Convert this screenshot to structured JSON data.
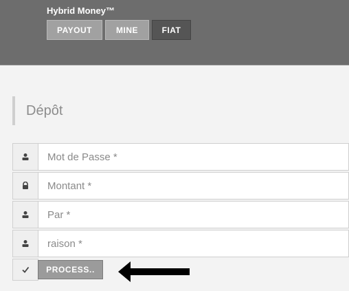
{
  "header": {
    "brand": "Hybrid Money™",
    "tabs": [
      {
        "label": "PAYOUT"
      },
      {
        "label": "MINE"
      },
      {
        "label": "FIAT",
        "active": true
      }
    ]
  },
  "section": {
    "title": "Dépôt"
  },
  "form": {
    "fields": [
      {
        "placeholder": "Mot de Passe *",
        "icon": "user-icon"
      },
      {
        "placeholder": "Montant *",
        "icon": "lock-icon"
      },
      {
        "placeholder": "Par *",
        "icon": "user-icon"
      },
      {
        "placeholder": "raison *",
        "icon": "user-icon"
      }
    ],
    "submit_label": "PROCESS..",
    "submit_icon": "check-icon"
  },
  "annotation": {
    "icon": "left-arrow-icon"
  }
}
